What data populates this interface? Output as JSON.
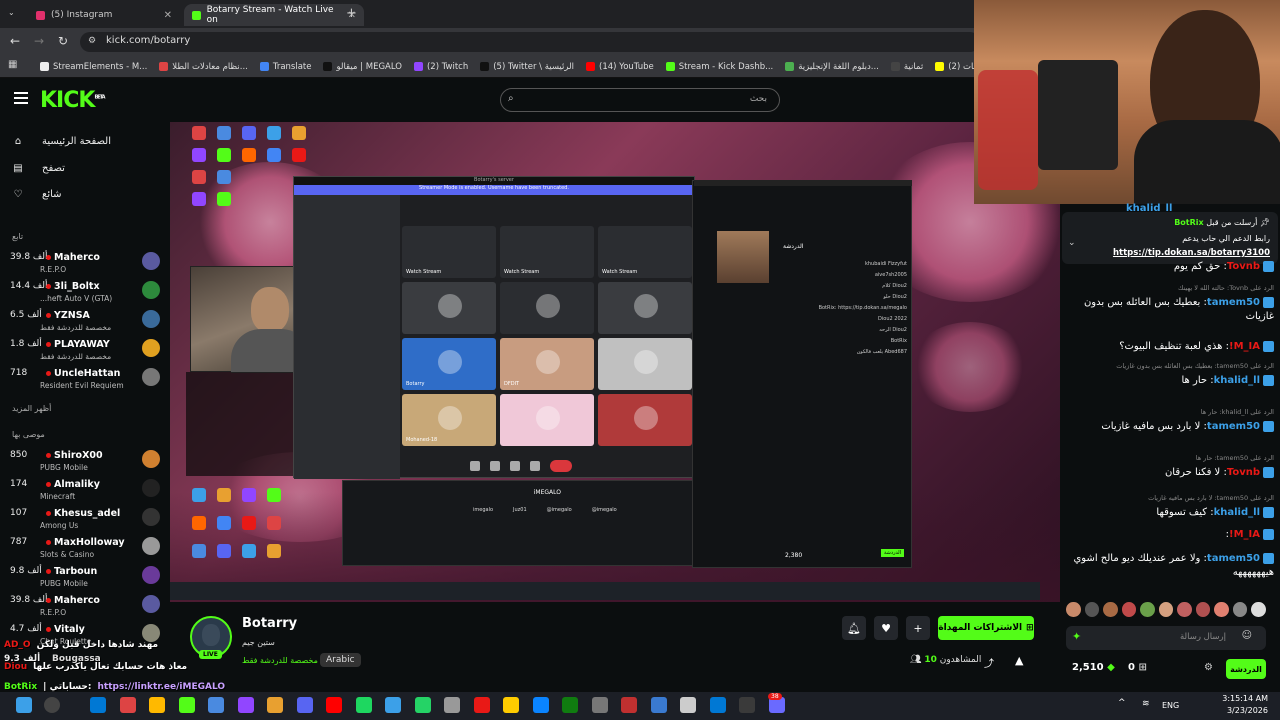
{
  "browser": {
    "tabs": [
      {
        "label": "(5) Instagram",
        "color": "#e1306c"
      },
      {
        "label": "Botarry Stream - Watch Live on",
        "color": "#53fc18"
      }
    ],
    "new_tab": "+",
    "url": "kick.com/botarry",
    "bookmarks": [
      {
        "label": "StreamElements - M...",
        "color": "#eee"
      },
      {
        "label": "نظام معادلات الطلا...",
        "color": "#d44"
      },
      {
        "label": "Translate",
        "color": "#4285f4"
      },
      {
        "label": "ميقالو | MEGALO",
        "color": "#111"
      },
      {
        "label": "(2) Twitch",
        "color": "#9146ff"
      },
      {
        "label": "(5) Twitter \\ الرئيسية",
        "color": "#111"
      },
      {
        "label": "(14) YouTube",
        "color": "#ff0000"
      },
      {
        "label": "Stream - Kick Dashb...",
        "color": "#53fc18"
      },
      {
        "label": "دبلوم اللغة الإنجليزية...",
        "color": "#4caf50"
      },
      {
        "label": "ثمانية",
        "color": "#444"
      },
      {
        "label": "(2) سناب شات",
        "color": "#fffc00"
      },
      {
        "label": "D",
        "color": "#e1306c"
      }
    ]
  },
  "kick": {
    "logo": "KICK",
    "logo_sup": "BETA",
    "search_placeholder": "بحث"
  },
  "sidebar": {
    "nav": [
      {
        "label": "الصفحة الرئيسية",
        "icon": "home-icon"
      },
      {
        "label": "تصفح",
        "icon": "browse-icon"
      },
      {
        "label": "شائع",
        "icon": "heart-icon"
      }
    ],
    "following_label": "تابع",
    "following": [
      {
        "count": "39.8 ألف",
        "name": "Maherco",
        "game": "R.E.P.O",
        "color": "#5a5aa0"
      },
      {
        "count": "14.4 ألف",
        "name": "3li_Boltx",
        "game": "...heft Auto V (GTA)",
        "color": "#2d8a3c"
      },
      {
        "count": "6.5 ألف",
        "name": "YZNSA",
        "game": "مخصصة للدردشة فقط",
        "color": "#3a6a9a"
      },
      {
        "count": "1.8 ألف",
        "name": "PLAYAWAY",
        "game": "مخصصة للدردشة فقط",
        "color": "#e0a020"
      },
      {
        "count": "718",
        "name": "UncleHattan",
        "game": "Resident Evil Requiem",
        "color": "#777"
      }
    ],
    "show_more": "أظهر المزيد",
    "recommended_label": "موصى بها",
    "recommended": [
      {
        "count": "850",
        "name": "ShiroX00",
        "game": "PUBG Mobile",
        "color": "#d08030"
      },
      {
        "count": "174",
        "name": "Almaliky",
        "game": "Minecraft",
        "color": "#222"
      },
      {
        "count": "107",
        "name": "Khesus_adel",
        "game": "Among Us",
        "color": "#333"
      },
      {
        "count": "787",
        "name": "MaxHolloway",
        "game": "Slots & Casino",
        "color": "#999"
      },
      {
        "count": "9.8 ألف",
        "name": "Tarboun",
        "game": "PUBG Mobile",
        "color": "#6a3a9a"
      },
      {
        "count": "39.8 ألف",
        "name": "Maherco",
        "game": "R.E.P.O",
        "color": "#5a5aa0"
      },
      {
        "count": "4.7 ألف",
        "name": "Vitaly",
        "game": "Chat Roulette",
        "color": "#887"
      }
    ]
  },
  "overlay_chat": [
    {
      "user": "AD_O",
      "text": "مهند شادها داخل قبل ولكن",
      "color": "#e91916"
    },
    {
      "user": "Diou",
      "text": "معاذ هات حسابك تعال ياكدرب علها",
      "color": "#e91916"
    },
    {
      "user": "BotRix",
      "text": "| حساباتي:",
      "link": "https://linktr.ee/iMEGALO",
      "color": "#53fc18"
    },
    {
      "user": "AD_O",
      "text": "هههههه",
      "color": "#e91916"
    }
  ],
  "overlay_counts": [
    "9.3 ألف",
    "Bougassa"
  ],
  "stream": {
    "name": "Botarry",
    "title": "ستين جيم",
    "category": "مخصصة للدردشة فقط",
    "language": "Arabic",
    "live": "LIVE",
    "subscribe_label": "الاشتراكات المهداة",
    "viewers_label": "المشاهدون",
    "viewers": "10"
  },
  "video": {
    "discord_title": "Botarry's server",
    "discord_banner": "Streamer Mode is enabled. Username have been truncated.",
    "tiles": [
      {
        "label": "Watch Stream",
        "color": "#2b2d31"
      },
      {
        "label": "Watch Stream",
        "color": "#2b2d31"
      },
      {
        "label": "Watch Stream",
        "color": "#2b2d31"
      },
      {
        "label": "",
        "color": "#3a3c40"
      },
      {
        "label": "",
        "color": "#2b2d31"
      },
      {
        "label": "",
        "color": "#3a3c40"
      },
      {
        "label": "Botarry",
        "color": "#2f6dc8"
      },
      {
        "label": "DFDIT",
        "color": "#c89c80"
      },
      {
        "label": "",
        "color": "#c0c0c0"
      },
      {
        "label": "Mohaned-18",
        "color": "#c8a878"
      },
      {
        "label": "",
        "color": "#f0c8d8"
      },
      {
        "label": "",
        "color": "#b03a3a"
      }
    ],
    "inner_chat_header": "الدردشة",
    "inner_chat_lines": [
      "khubaidi Fizzyfut",
      "aive7sh2005",
      "Diou2 كلام",
      "Diou2 حلو",
      "BotRix: https://tip.dokan.sa/megalo",
      "Diou2 2022",
      "Diou2 الرحه",
      "BotRix",
      "Abed687 يلعب فالكون"
    ],
    "inner_chat_count": "2,380",
    "inner_chat_send": "الدردشة",
    "megalo_name": "iMEGALO",
    "megalo_handles": [
      "imegalo",
      "Juz01",
      "@imegalo",
      "@imegalo"
    ]
  },
  "chat": {
    "pinned_user": "BotRix",
    "pinned_by": "أرسلت من قبل",
    "pinned_text": "رابط الدعم الي حاب يدعم",
    "pinned_link": "https://tip.dokan.sa/botarry3100",
    "top_user": "khalid_ll",
    "messages": [
      {
        "reply": "",
        "user": "Tovnb",
        "text": "حق كم يوم",
        "color": "#e91916"
      },
      {
        "reply": "الرد على Tovnb: حالته الله لا يهينك",
        "user": "tamem50",
        "text": "بعطيك بس العائله بس بدون غازيات",
        "color": "#3ca0e8"
      },
      {
        "reply": "",
        "user": "M_IA!",
        "text": "هذي لعبة تنظيف البيوت؟",
        "color": "#e91916"
      },
      {
        "reply": "الرد على tamem50: بعطيك بس العائله بس بدون غازيات",
        "user": "khalid_ll",
        "text": "حار ها",
        "color": "#3ca0e8"
      },
      {
        "reply": "الرد على khalid_ll: حار ها",
        "user": "tamem50",
        "text": "لا بارد بس مافيه غازيات",
        "color": "#3ca0e8"
      },
      {
        "reply": "الرد على tamem50: حار ها",
        "user": "Tovnb",
        "text": "لا فكنا حرقان",
        "color": "#e91916"
      },
      {
        "reply": "الرد على tamem50: لا بارد بس مافيه غازيات",
        "user": "khalid_ll",
        "text": "كيف تسوقها",
        "color": "#3ca0e8"
      },
      {
        "reply": "",
        "user": "M_IA!",
        "text": "",
        "color": "#e91916"
      },
      {
        "reply": "",
        "user": "tamem50",
        "text": "ولا عمر عنديلك ديو مالح اشوي هيههههههه",
        "color": "#3ca0e8"
      }
    ],
    "input_placeholder": "إرسال رسالة",
    "points": "2,510",
    "zero": "0",
    "send_label": "الدردشة"
  },
  "taskbar": {
    "lang": "ENG",
    "time": "3:15:14 AM",
    "date": "3/23/2026",
    "badge": "38"
  }
}
